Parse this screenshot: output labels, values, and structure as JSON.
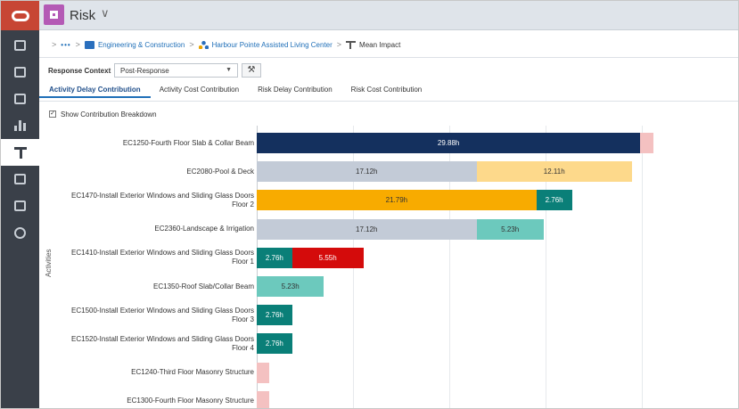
{
  "app": {
    "title": "Risk",
    "chevron": "∨"
  },
  "breadcrumb": {
    "dots": "•••",
    "items": [
      {
        "label": "Engineering & Construction",
        "icon": "portfolio-icon"
      },
      {
        "label": "Harbour Pointe Assisted Living Center",
        "icon": "project-nodes-icon"
      },
      {
        "label": "Mean Impact",
        "icon": "tornado-chart-icon"
      }
    ]
  },
  "rail": {
    "items": [
      {
        "icon": "list-icon"
      },
      {
        "icon": "dashboard-icon"
      },
      {
        "icon": "register-icon"
      },
      {
        "icon": "bar-chart-icon"
      },
      {
        "icon": "tornado-chart-icon",
        "active": true
      },
      {
        "icon": "analysis-icon"
      },
      {
        "icon": "tools-icon"
      },
      {
        "icon": "settings-icon"
      }
    ]
  },
  "context": {
    "label": "Response Context",
    "value": "Post-Response",
    "tool_icon": "wrench-icon"
  },
  "tabs": [
    {
      "label": "Activity Delay Contribution",
      "active": true
    },
    {
      "label": "Activity Cost Contribution",
      "active": false
    },
    {
      "label": "Risk Delay Contribution",
      "active": false
    },
    {
      "label": "Risk Cost Contribution",
      "active": false
    }
  ],
  "breakdown": {
    "label": "Show Contribution Breakdown",
    "checked": true
  },
  "colors": {
    "navy": "#14305e",
    "pink": "#f4c1c1",
    "gray": "#c3cbd7",
    "yellow": "#fdd98b",
    "orange": "#f8ab00",
    "teal": "#0a7f78",
    "lightteal": "#6cc9bd",
    "red": "#d40b0b"
  },
  "chart_data": {
    "type": "bar",
    "orientation": "horizontal",
    "stacked": true,
    "ylabel": "Activities",
    "unit": "h",
    "categories": [
      "EC1250-Fourth Floor Slab & Collar Beam",
      "EC2080-Pool & Deck",
      "EC1470-Install Exterior Windows and Sliding Glass Doors Floor 2",
      "EC2360-Landscape & Irrigation",
      "EC1410-Install Exterior Windows and Sliding Glass Doors Floor 1",
      "EC1350-Roof Slab/Collar Beam",
      "EC1500-Install Exterior Windows and Sliding Glass Doors Floor 3",
      "EC1520-Install Exterior Windows and Sliding Glass Doors Floor 4",
      "EC1240-Third Floor Masonry Structure",
      "EC1300-Fourth Floor Masonry Structure"
    ],
    "segments": [
      [
        {
          "value": 29.88,
          "label": "29.88h",
          "color": "navy"
        },
        {
          "value": 1.0,
          "label": "",
          "color": "pink"
        }
      ],
      [
        {
          "value": 17.12,
          "label": "17.12h",
          "color": "gray"
        },
        {
          "value": 12.11,
          "label": "12.11h",
          "color": "yellow"
        }
      ],
      [
        {
          "value": 21.79,
          "label": "21.79h",
          "color": "orange"
        },
        {
          "value": 2.76,
          "label": "2.76h",
          "color": "teal"
        }
      ],
      [
        {
          "value": 17.12,
          "label": "17.12h",
          "color": "gray"
        },
        {
          "value": 5.23,
          "label": "5.23h",
          "color": "lightteal"
        }
      ],
      [
        {
          "value": 2.76,
          "label": "2.76h",
          "color": "teal"
        },
        {
          "value": 5.55,
          "label": "5.55h",
          "color": "red"
        }
      ],
      [
        {
          "value": 5.23,
          "label": "5.23h",
          "color": "lightteal"
        }
      ],
      [
        {
          "value": 2.76,
          "label": "2.76h",
          "color": "teal"
        }
      ],
      [
        {
          "value": 2.76,
          "label": "2.76h",
          "color": "teal"
        }
      ],
      [
        {
          "value": 1.0,
          "label": "",
          "color": "pink"
        }
      ],
      [
        {
          "value": 1.0,
          "label": "",
          "color": "pink"
        }
      ]
    ],
    "xlim": [
      0,
      35
    ]
  }
}
